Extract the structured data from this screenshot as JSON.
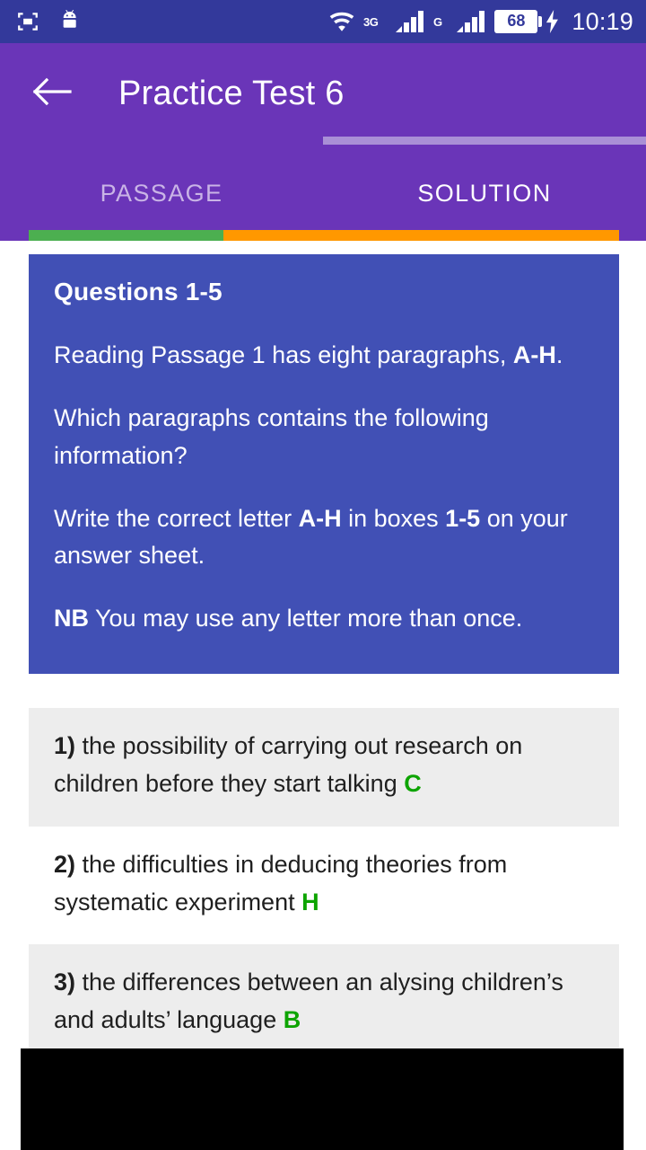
{
  "statusbar": {
    "left_icons": [
      "screenshot-crop-icon",
      "android-robot-icon"
    ],
    "right_icons": [
      "wifi-icon",
      "network-3g-icon",
      "signal-bars-1-icon",
      "network-g-icon",
      "signal-bars-2-icon",
      "battery-icon",
      "charging-bolt-icon"
    ],
    "network_3g_label": "3G",
    "network_g_label": "G",
    "battery_level": "68",
    "clock": "10:19"
  },
  "appbar": {
    "back_icon": "back-arrow-icon",
    "title": "Practice Test 6"
  },
  "tabs": {
    "items": [
      {
        "label": "PASSAGE",
        "active": false
      },
      {
        "label": "SOLUTION",
        "active": true
      }
    ]
  },
  "progress": {
    "segments": [
      {
        "name": "green-segment",
        "color": "#4CAF50",
        "percent": 33
      },
      {
        "name": "orange-segment",
        "color": "#FF9800",
        "percent": 67
      }
    ]
  },
  "question_card": {
    "heading": "Questions 1-5",
    "lines": [
      [
        {
          "t": "Reading Passage 1 has eight paragraphs, ",
          "b": false
        },
        {
          "t": "A-H",
          "b": true
        },
        {
          "t": ".",
          "b": false
        }
      ],
      [
        {
          "t": "Which paragraphs contains the following information?",
          "b": false
        }
      ],
      [
        {
          "t": "Write the correct letter ",
          "b": false
        },
        {
          "t": "A-H",
          "b": true
        },
        {
          "t": " in boxes ",
          "b": false
        },
        {
          "t": "1-5",
          "b": true
        },
        {
          "t": " on your answer sheet.",
          "b": false
        }
      ],
      [
        {
          "t": "NB",
          "b": true
        },
        {
          "t": " You may use any letter more than once.",
          "b": false
        }
      ]
    ],
    "background_color": "#4150B5"
  },
  "answers": {
    "answer_color": "#0DA400",
    "items": [
      {
        "num": "1)",
        "text": " the possibility of carrying out research on children before they start talking ",
        "letter": "C",
        "shaded": true
      },
      {
        "num": "2)",
        "text": " the difficulties in deducing theories from systematic experiment ",
        "letter": "H",
        "shaded": false
      },
      {
        "num": "3)",
        "text": " the differences between an alysing children’s and adults’ language ",
        "letter": "B",
        "shaded": true
      }
    ]
  },
  "overlay": {
    "name": "bottom-black-overlay",
    "color": "#000000"
  },
  "theme": {
    "primary": "#6A35B8",
    "statusbar": "#33399B",
    "card_blue": "#4150B5",
    "shaded_row": "#EDEDED",
    "tab_indicator": "#A98FD6"
  }
}
